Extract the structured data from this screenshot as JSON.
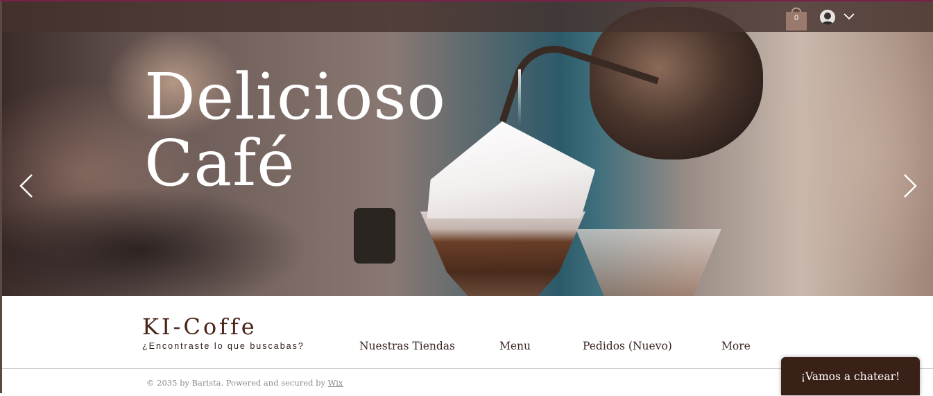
{
  "hero": {
    "title_line1": "Delicioso",
    "title_line2": "Café"
  },
  "header": {
    "cart_count": "0",
    "icons": {
      "cart": "shopping-bag-icon",
      "avatar": "user-avatar-icon",
      "menu": "chevron-down-icon"
    }
  },
  "slider": {
    "prev_icon": "chevron-left-icon",
    "next_icon": "chevron-right-icon"
  },
  "footer": {
    "brand": "KI-Coffe",
    "tagline": "¿Encontraste lo que buscabas?",
    "nav": [
      "Nuestras Tiendas",
      "Menu",
      "Pedidos (Nuevo)",
      "More"
    ],
    "copyright_text": "© 2035 by Barista. Powered and secured by ",
    "copyright_link": "Wix",
    "chat_label": "¡Vamos a chatear!"
  },
  "colors": {
    "brand_text": "#4a2418",
    "chat_bg": "#3a2118",
    "topbar": "#46322d",
    "accent": "#7a1f4a"
  }
}
